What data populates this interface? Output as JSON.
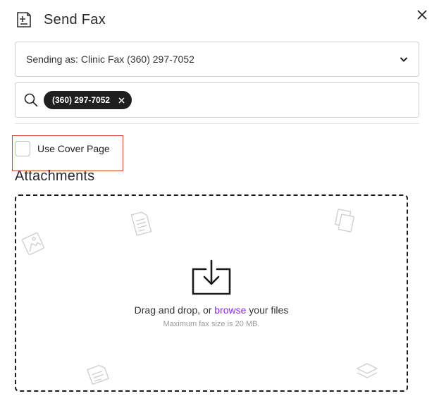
{
  "header": {
    "title": "Send Fax"
  },
  "sender": {
    "value": "Sending as: Clinic Fax (360) 297-7052"
  },
  "recipients": {
    "chips": [
      "(360) 297-7052"
    ]
  },
  "cover": {
    "label": "Use Cover Page",
    "checked": false
  },
  "attachments": {
    "title": "Attachments",
    "prompt_prefix": "Drag and drop, or ",
    "browse_label": "browse",
    "prompt_suffix": " your files",
    "hint": "Maximum fax size is 20 MB."
  },
  "colors": {
    "accent": "#8a2be2",
    "highlight": "#d9442f",
    "chip_bg": "#1f1f1f"
  }
}
